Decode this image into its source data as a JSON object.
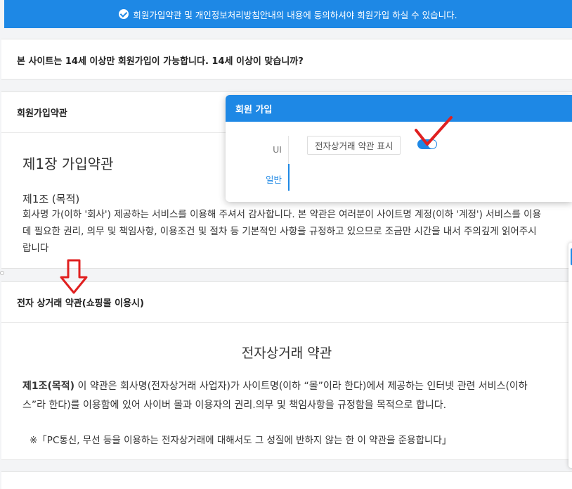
{
  "banner": {
    "text": "회원가입약관 및 개인정보처리방침안내의 내용에 동의하셔야 회원가입 하실 수 있습니다."
  },
  "age_check": {
    "question": "본 사이트는 14세 이상만 회원가입이 가능합니다. 14세 이상이 맞습니까?"
  },
  "terms": {
    "header": "회원가입약관",
    "chapter": "제1장 가입약관",
    "article": "제1조 (목적)",
    "lines": [
      "회사명 가(이하 '회사') 제공하는 서비스를 이용해 주셔서 감사합니다. 본 약관은 여러분이 사이트명 계정(이하 '계정') 서비스를 이용",
      "데 필요한 권리, 의무 및 책임사항, 이용조건 및 절차 등 기본적인 사항을 규정하고 있으므로 조금만 시간을 내서 주의깊게 읽어주시",
      "랍니다"
    ]
  },
  "commerce": {
    "header": "전자 상거래 약관(쇼핑몰 이용시)",
    "title": "전자상거래 약관",
    "article_label": "제1조(목적)",
    "article_line1": " 이 약관은 회사명(전자상거래 사업자)가 사이트명(이하 “몰”이라 한다)에서 제공하는 인터넷 관련 서비스(이하",
    "article_line2": "스”라 한다)를 이용함에 있어 사이버 몰과 이용자의 권리.의무 및 책임사항을 규정함을 목적으로 합니다.",
    "note": "※「PC통신, 무선 등을 이용하는 전자상거래에 대해서도 그 성질에 반하지 않는 한 이 약관을 준용합니다」"
  },
  "popup": {
    "title": "회원 가입",
    "sidebar": [
      "UI",
      "일반"
    ],
    "option_label": "전자상거래 약관 표시",
    "toggle_on": true
  },
  "colors": {
    "accent": "#1e88e5",
    "annotation": "#e02020"
  }
}
